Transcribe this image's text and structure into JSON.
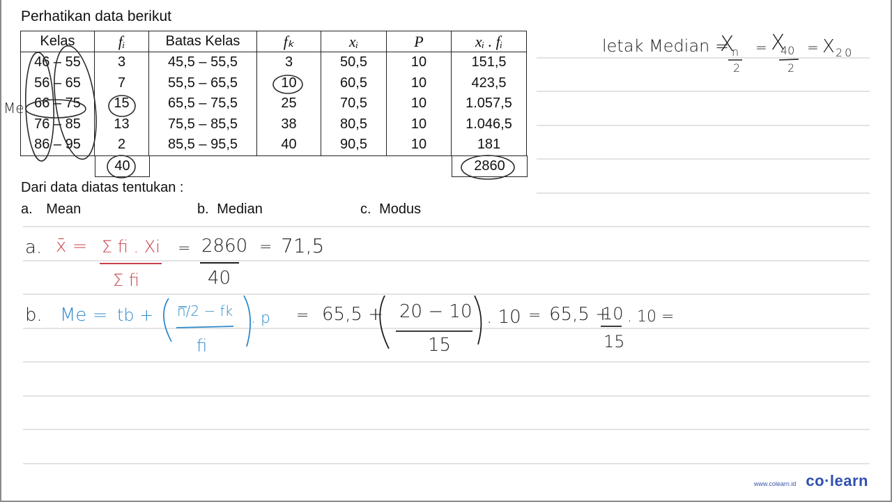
{
  "worksheet": {
    "title": "Perhatikan data berikut",
    "table": {
      "headers": [
        "Kelas",
        "fᵢ",
        "Batas Kelas",
        "fₖ",
        "xᵢ",
        "P",
        "xᵢ . fᵢ"
      ],
      "rows": [
        [
          "46 – 55",
          "3",
          "45,5 – 55,5",
          "3",
          "50,5",
          "10",
          "151,5"
        ],
        [
          "56 – 65",
          "7",
          "55,5 – 65,5",
          "10",
          "60,5",
          "10",
          "423,5"
        ],
        [
          "66 – 75",
          "15",
          "65,5 – 75,5",
          "25",
          "70,5",
          "10",
          "1.057,5"
        ],
        [
          "76 – 85",
          "13",
          "75,5 – 85,5",
          "38",
          "80,5",
          "10",
          "1.046,5"
        ],
        [
          "86 – 95",
          "2",
          "85,5 – 95,5",
          "40",
          "90,5",
          "10",
          "181"
        ]
      ],
      "sum_fi": "40",
      "sum_xifi": "2860"
    },
    "question": "Dari data diatas tentukan :",
    "options": [
      {
        "letter": "a.",
        "label": "Mean"
      },
      {
        "letter": "b.",
        "label": "Median"
      },
      {
        "letter": "c.",
        "label": "Modus"
      }
    ]
  },
  "annotations": {
    "me_label": "Me",
    "median_position": {
      "prefix": "letak Median =",
      "x1": "X",
      "sub1_num": "n",
      "sub1_den": "2",
      "eq1": "=",
      "x2": "X",
      "sub2_num": "40",
      "sub2_den": "2",
      "eq2": "=",
      "result": "X",
      "result_sub": "20"
    },
    "mean": {
      "letter": "a.",
      "lhs": "x̄ =",
      "formula_num": "Σ fi . Xi",
      "formula_den": "Σ fi",
      "eq1": "=",
      "num": "2860",
      "den": "40",
      "eq2": "=",
      "result": "71,5"
    },
    "median": {
      "letter": "b.",
      "lhs": "Me =",
      "tb": "tb +",
      "formula_num": "n/2 − fk",
      "formula_den": "fi",
      "formula_tail": ". p",
      "eq1": "=",
      "step1_prefix": "65,5 +",
      "step1_num": "20 − 10",
      "step1_den": "15",
      "step1_tail": ". 10",
      "eq2": "=",
      "step2_prefix": "65,5 +",
      "step2_num": "10",
      "step2_den": "15",
      "step2_tail": ". 10 ="
    }
  },
  "branding": {
    "url": "www.colearn.id",
    "brand": "co·learn"
  },
  "colors": {
    "ink_black": "#1e1e1e",
    "ink_red": "#c8404a",
    "ink_blue": "#2f8ac9",
    "brand_blue": "#2f4fb0"
  }
}
